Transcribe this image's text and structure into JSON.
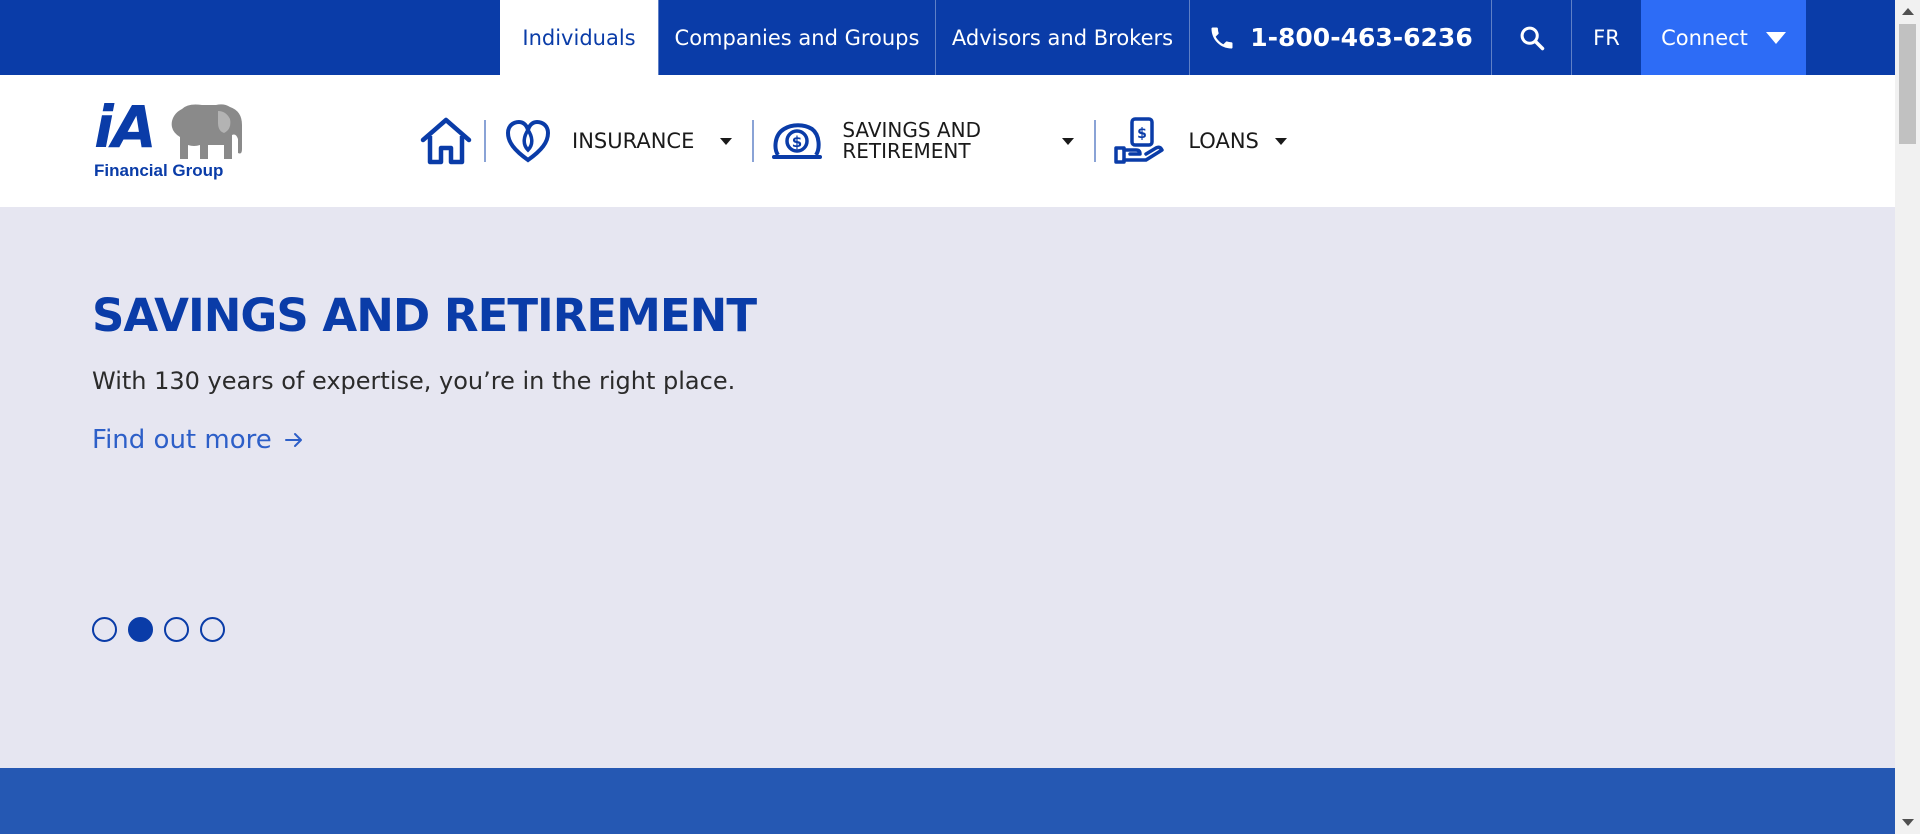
{
  "topnav": {
    "individuals": "Individuals",
    "companies": "Companies and Groups",
    "advisors": "Advisors and Brokers",
    "phone": "1-800-463-6236",
    "lang": "FR",
    "connect": "Connect"
  },
  "logo": {
    "mark": "iA",
    "tagline": "Financial Group"
  },
  "mainnav": {
    "insurance": "INSURANCE",
    "savings": "SAVINGS AND RETIREMENT",
    "loans": "LOANS"
  },
  "hero": {
    "title": "SAVINGS AND RETIREMENT",
    "subtitle": "With 130 years of expertise, you’re in the right place.",
    "link": "Find out more",
    "slide_count": 4,
    "active_slide": 2
  },
  "colors": {
    "brand_blue": "#0a3ca8",
    "accent_blue": "#2d6cf6",
    "hero_bg": "#e6e6f1",
    "band_blue": "#2558b3"
  },
  "icons": [
    "phone-icon",
    "search-icon",
    "chevron-down-icon",
    "home-icon",
    "heart-icon",
    "piggy-coin-icon",
    "hand-dollar-icon",
    "arrow-right-icon",
    "elephant-icon"
  ]
}
